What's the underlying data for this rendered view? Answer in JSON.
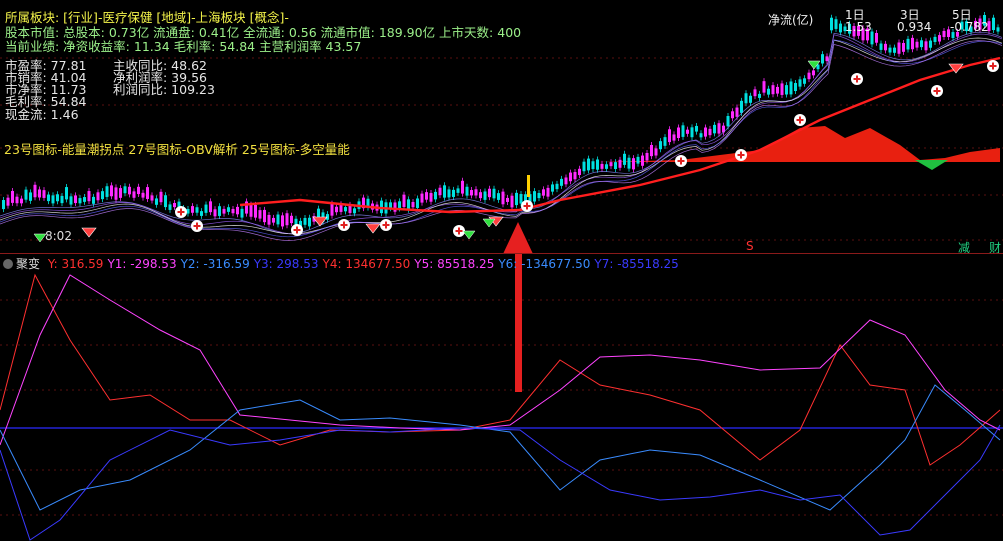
{
  "header": {
    "sector_line": "所属板块: [行业]-医疗保健 [地域]-上海板块 [概念]-",
    "capital_line": "股本市值: 总股本: 0.73亿 流通盘: 0.41亿 全流通: 0.56 流通市值: 189.90亿 上市天数: 400",
    "performance_line": "当前业绩: 净资收益率: 11.34 毛利率: 54.84 主营利润率 43.57"
  },
  "stats_left": [
    "市盈率: 77.81",
    "市销率: 41.04",
    "市净率: 11.73",
    "毛利率: 54.84",
    "现金流: 1.46"
  ],
  "stats_right": [
    "主收同比: 48.62",
    "净利润率: 39.56",
    "利润同比: 109.23"
  ],
  "indicator_legend": "23号图标-能量潮拐点 27号图标-OBV解析 25号图标-多空量能",
  "net_flow": {
    "label": "净流(亿)",
    "cols": [
      {
        "period": "1日",
        "value": "1.53"
      },
      {
        "period": "3日",
        "value": "0.934"
      },
      {
        "period": "5日",
        "value": "-0.782"
      }
    ]
  },
  "bottom_badges": {
    "left": "8:02",
    "s": "S",
    "jian": "减",
    "cai": "财"
  },
  "indicator": {
    "name": "聚变",
    "values": [
      {
        "label": "Y: 316.59",
        "color": "#ff3030"
      },
      {
        "label": "Y1: -298.53",
        "color": "#ff44ff"
      },
      {
        "label": "Y2: -316.59",
        "color": "#3a8cff"
      },
      {
        "label": "Y3: 298.53",
        "color": "#3a3aff"
      },
      {
        "label": "Y4: 134677.50",
        "color": "#ff3030"
      },
      {
        "label": "Y5: 85518.25",
        "color": "#ff44ff"
      },
      {
        "label": "Y6: -134677.50",
        "color": "#3a8cff"
      },
      {
        "label": "Y7: -85518.25",
        "color": "#3a3aff"
      }
    ]
  },
  "colors": {
    "ma_line": "#ff1e1e",
    "candle_up": "#ff2aff",
    "candle_down": "#00e0e0",
    "arrow": "#e62020",
    "zero_line": "#2a2aff"
  }
}
